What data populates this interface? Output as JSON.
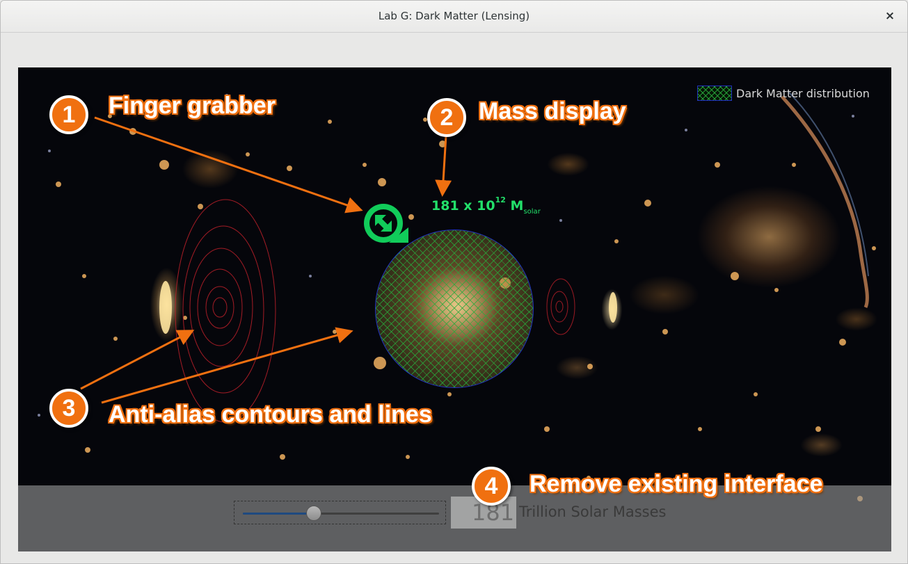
{
  "window": {
    "title": "Lab G: Dark Matter (Lensing)",
    "close_glyph": "×"
  },
  "legend": {
    "label": "Dark Matter distribution"
  },
  "mass_readout": {
    "value": "181 x 10",
    "exponent": "12",
    "unit": "M",
    "unit_subscript": "solar"
  },
  "annotations": [
    {
      "number": "1",
      "label": "Finger grabber"
    },
    {
      "number": "2",
      "label": "Mass display"
    },
    {
      "number": "3",
      "label": "Anti-alias contours and lines"
    },
    {
      "number": "4",
      "label": "Remove existing interface"
    }
  ],
  "controls": {
    "slider": {
      "min": 0,
      "max": 500,
      "value": 181
    },
    "value_box": "181",
    "units_label": "Trillion Solar Masses"
  },
  "colors": {
    "accent_orange": "#f07010",
    "mass_green": "#22e06a",
    "dm_outline_blue": "#2030c0"
  }
}
